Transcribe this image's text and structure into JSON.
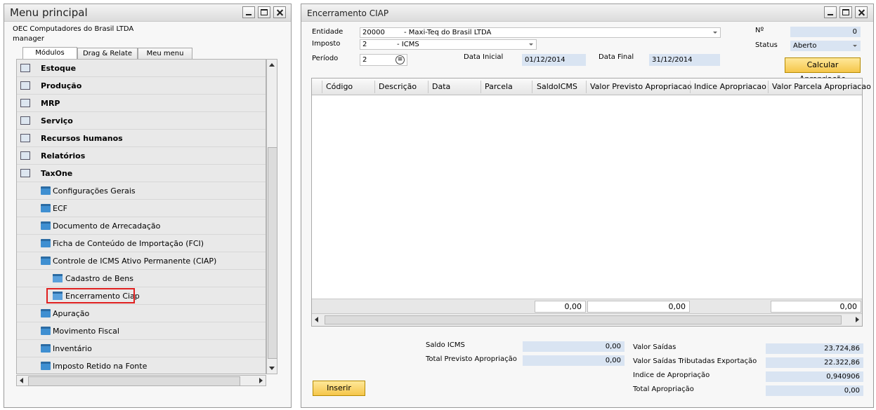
{
  "menu": {
    "title": "Menu principal",
    "company": "OEC Computadores do Brasil LTDA",
    "user": "manager",
    "tabs": [
      {
        "label": "Módulos"
      },
      {
        "label": "Drag & Relate"
      },
      {
        "label": "Meu menu"
      }
    ],
    "modules": [
      {
        "label": "Estoque",
        "icon": "inventory-icon"
      },
      {
        "label": "Produção",
        "icon": "production-icon"
      },
      {
        "label": "MRP",
        "icon": "mrp-icon"
      },
      {
        "label": "Serviço",
        "icon": "service-icon"
      },
      {
        "label": "Recursos humanos",
        "icon": "hr-icon"
      },
      {
        "label": "Relatórios",
        "icon": "reports-icon"
      },
      {
        "label": "TaxOne",
        "icon": "taxone-icon"
      }
    ],
    "taxone_items": [
      {
        "label": "Configurações Gerais"
      },
      {
        "label": "ECF"
      },
      {
        "label": "Documento de Arrecadação"
      },
      {
        "label": "Ficha de Conteúdo de Importação (FCI)"
      },
      {
        "label": "Controle de ICMS Ativo Permanente (CIAP)"
      }
    ],
    "ciap_items": [
      {
        "label": "Cadastro de Bens"
      },
      {
        "label": "Encerramento Ciap"
      }
    ],
    "more_items": [
      {
        "label": "Apuração"
      },
      {
        "label": "Movimento Fiscal"
      },
      {
        "label": "Inventário"
      },
      {
        "label": "Imposto Retido na Fonte"
      }
    ]
  },
  "form": {
    "title": "Encerramento CIAP",
    "entidade_label": "Entidade",
    "entidade_code": "20000",
    "entidade_name": "- Maxi-Teq do Brasil LTDA",
    "imposto_label": "Imposto",
    "imposto_code": "2",
    "imposto_name": "- ICMS",
    "periodo_label": "Período",
    "periodo_value": "2",
    "data_inicial_label": "Data Inicial",
    "data_inicial_value": "01/12/2014",
    "data_final_label": "Data Final",
    "data_final_value": "31/12/2014",
    "numero_label": "Nº",
    "numero_value": "0",
    "status_label": "Status",
    "status_value": "Aberto",
    "calcular_label": "Calcular Apropriação",
    "grid_columns": [
      {
        "label": "Código"
      },
      {
        "label": "Descrição"
      },
      {
        "label": "Data"
      },
      {
        "label": "Parcela"
      },
      {
        "label": "SaldoICMS"
      },
      {
        "label": "Valor Previsto Apropriacao"
      },
      {
        "label": "Indice Apropriacao"
      },
      {
        "label": "Valor Parcela Apropriacao"
      }
    ],
    "grid_totals": {
      "saldo": "0,00",
      "previsto": "0,00",
      "parcela": "0,00"
    },
    "saldo_icms_label": "Saldo ICMS",
    "saldo_icms_value": "0,00",
    "total_previsto_label": "Total Previsto Apropriação",
    "total_previsto_value": "0,00",
    "valor_saidas_label": "Valor Saídas",
    "valor_saidas_value": "23.724,86",
    "valor_saidas_exp_label": "Valor Saídas Tributadas Exportação",
    "valor_saidas_exp_value": "22.322,86",
    "indice_label": "Indice de Apropriação",
    "indice_value": "0,940906",
    "total_aprop_label": "Total Apropriação",
    "total_aprop_value": "0,00",
    "inserir_label": "Inserir"
  },
  "colors": {
    "readonly_field": "#d9e4f2",
    "button_yellow": "#f5c64a",
    "highlight_red": "#e02020",
    "folder_blue": "#3f8fd1"
  }
}
